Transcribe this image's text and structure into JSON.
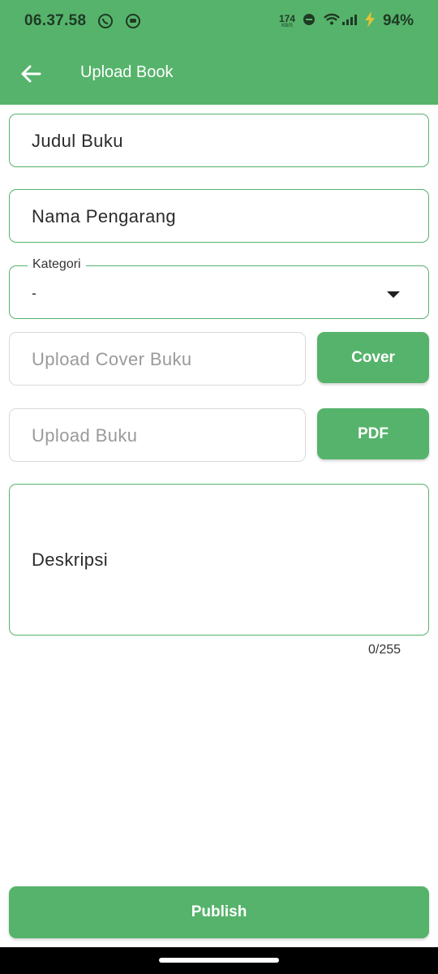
{
  "status_bar": {
    "time": "06.37.58",
    "net_speed": "174",
    "net_unit": "KB/S",
    "battery": "94%"
  },
  "app_bar": {
    "title": "Upload Book"
  },
  "form": {
    "judul": "Judul Buku",
    "pengarang": "Nama Pengarang",
    "kategori": {
      "label": "Kategori",
      "value": "-"
    },
    "cover": {
      "placeholder": "Upload Cover Buku",
      "button": "Cover"
    },
    "buku": {
      "placeholder": "Upload Buku",
      "button": "PDF"
    },
    "deskripsi": {
      "text": "Deskripsi",
      "counter": "0/255"
    }
  },
  "footer": {
    "publish": "Publish"
  },
  "colors": {
    "primary": "#56b36b",
    "disabled_border": "#d9d9d9"
  }
}
